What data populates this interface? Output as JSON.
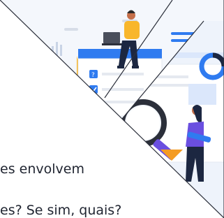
{
  "caption": {
    "line1": "es envolvem",
    "line2": "es? Se sim, quais?"
  },
  "colors": {
    "accent_blue": "#2f7bf0",
    "light_blue": "#dbe7fb",
    "yellow": "#f8b62b",
    "orange": "#f49b22",
    "purple": "#6a4fe0",
    "navy": "#1c2741",
    "skin": "#c46f4a"
  },
  "icons": [
    "question-mark-icon",
    "checkbox-icon",
    "magnifying-glass-icon",
    "donut-chart-icon",
    "laptop-icon"
  ]
}
